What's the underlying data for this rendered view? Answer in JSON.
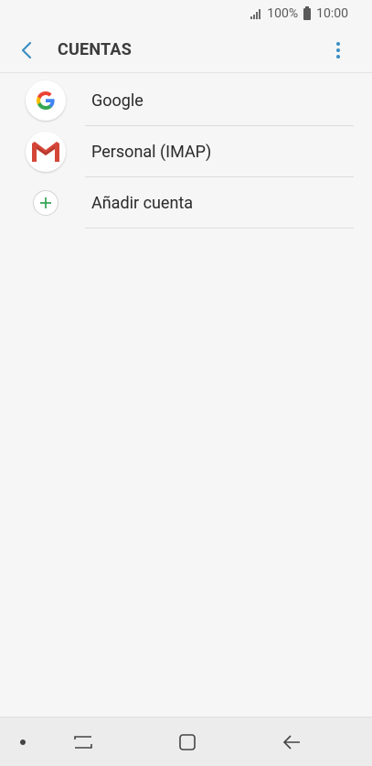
{
  "status_bar": {
    "battery_text": "100%",
    "time": "10:00"
  },
  "header": {
    "title": "CUENTAS"
  },
  "accounts": [
    {
      "label": "Google",
      "icon": "google-icon"
    },
    {
      "label": "Personal (IMAP)",
      "icon": "gmail-icon"
    },
    {
      "label": "Añadir cuenta",
      "icon": "add-icon"
    }
  ],
  "colors": {
    "accent": "#3b8fc4",
    "add_green": "#3aa65a",
    "gmail_red": "#d44638"
  }
}
